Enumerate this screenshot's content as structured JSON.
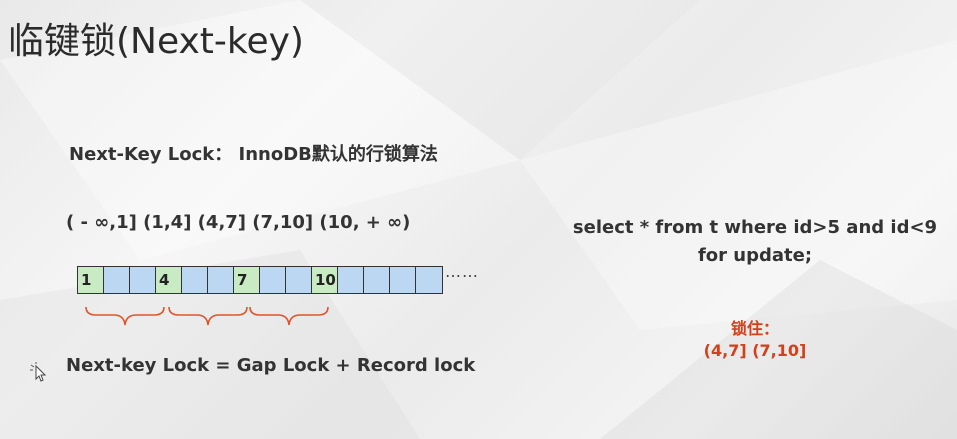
{
  "slide": {
    "title": "临键锁(Next-key)",
    "subtitle": "Next-Key Lock： InnoDB默认的行锁算法",
    "intervals": "( - ∞,1] (1,4] (4,7] (7,10] (10, + ∞)",
    "cells": [
      "1",
      "",
      "",
      "4",
      "",
      "",
      "7",
      "",
      "",
      "10",
      "",
      "",
      "",
      ""
    ],
    "record_cells": [
      0,
      3,
      6,
      9
    ],
    "ellipsis": "……",
    "formula": "Next-key Lock = Gap Lock + Record lock",
    "sql_line1": "select * from t where id>5 and id<9",
    "sql_line2": "for update;",
    "locked_label": "锁住：",
    "locked_ranges": "(4,7] (7,10]",
    "colors": {
      "record_cell": "#c9ebc3",
      "gap_cell": "#bcd7f1",
      "brace": "#e0542a",
      "highlight": "#d4401a"
    }
  }
}
